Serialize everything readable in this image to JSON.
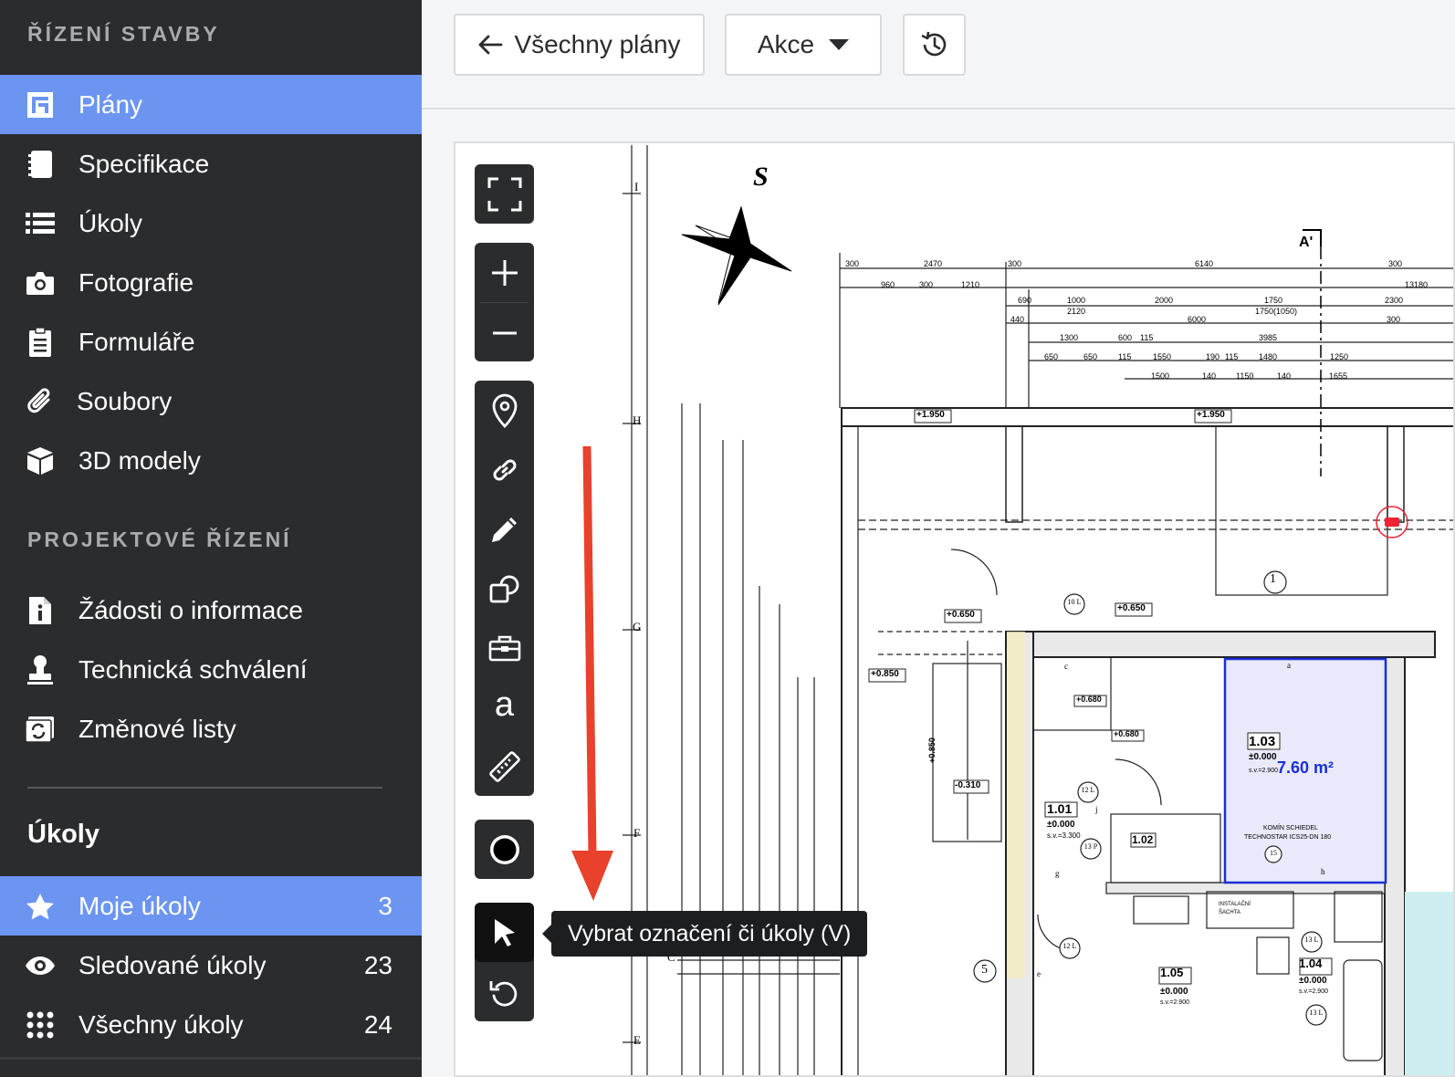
{
  "sidebar": {
    "section1_title": "ŘÍZENÍ STAVBY",
    "items": [
      {
        "label": "Plány",
        "icon": "plan-icon",
        "active": true
      },
      {
        "label": "Specifikace",
        "icon": "notebook-icon"
      },
      {
        "label": "Úkoly",
        "icon": "list-icon"
      },
      {
        "label": "Fotografie",
        "icon": "camera-icon"
      },
      {
        "label": "Formuláře",
        "icon": "clipboard-icon"
      },
      {
        "label": "Soubory",
        "icon": "paperclip-icon"
      },
      {
        "label": "3D modely",
        "icon": "cube-icon"
      }
    ],
    "section2_title": "PROJEKTOVÉ ŘÍZENÍ",
    "items2": [
      {
        "label": "Žádosti o informace",
        "icon": "info-file-icon"
      },
      {
        "label": "Technická schválení",
        "icon": "stamp-icon"
      },
      {
        "label": "Změnové listy",
        "icon": "change-icon"
      }
    ],
    "tasks_title": "Úkoly",
    "tasks": [
      {
        "label": "Moje úkoly",
        "count": "3",
        "icon": "star-icon",
        "active": true
      },
      {
        "label": "Sledované úkoly",
        "count": "23",
        "icon": "eye-icon"
      },
      {
        "label": "Všechny úkoly",
        "count": "24",
        "icon": "grid-icon"
      }
    ]
  },
  "toolbar": {
    "back_label": "Všechny plány",
    "actions_label": "Akce"
  },
  "tooltip": {
    "text": "Vybrat označení či úkoly (V)"
  },
  "plan": {
    "compass": "S",
    "section_mark": "A'",
    "grid_letters": [
      "I",
      "H",
      "G",
      "F",
      "E"
    ],
    "dims_top": [
      "300",
      "2470",
      "300",
      "6140",
      "300",
      "960",
      "300",
      "1210",
      "13180",
      "690",
      "1000",
      "2120",
      "2000",
      "1750",
      "1750(1050)",
      "2300",
      "440",
      "6000",
      "300",
      "1300",
      "600",
      "115",
      "3985",
      "650",
      "650",
      "115",
      "1550",
      "190",
      "115",
      "1480",
      "1250",
      "1500",
      "140",
      "1150",
      "140",
      "1655"
    ],
    "levels": [
      "+1.950",
      "+1.950",
      "+0.650",
      "+0.650",
      "+0.850",
      "+0.680",
      "+0.680",
      "-0.310",
      "+0.850"
    ],
    "rooms": [
      {
        "id": "1.01",
        "level": "±0.000",
        "sv": "s.v.=3.300"
      },
      {
        "id": "1.02",
        "level": "",
        "sv": ""
      },
      {
        "id": "1.03",
        "level": "±0.000",
        "sv": "s.v.=2.900",
        "area": "7.60 m²"
      },
      {
        "id": "1.04",
        "level": "±0.000",
        "sv": "s.v.=2.900"
      },
      {
        "id": "1.05",
        "level": "±0.000",
        "sv": "s.v.=2.900"
      }
    ],
    "chimney": "KOMÍN SCHIEDEL",
    "chimney2": "TECHNOSTAR ICS25-DN 180",
    "shaft": "INSTALAČNÍ ŠACHTA",
    "markers": [
      "1",
      "5",
      "10 L",
      "12 L",
      "12 L",
      "13 P",
      "13 L",
      "13 L",
      "15"
    ],
    "letters": [
      "a",
      "c",
      "e",
      "g",
      "h",
      "j",
      "C"
    ]
  },
  "colors": {
    "accent": "#6b95f1",
    "sidebar": "#2b2c2e",
    "arrow": "#e8412c",
    "room_highlight": "#1a2fd6"
  }
}
